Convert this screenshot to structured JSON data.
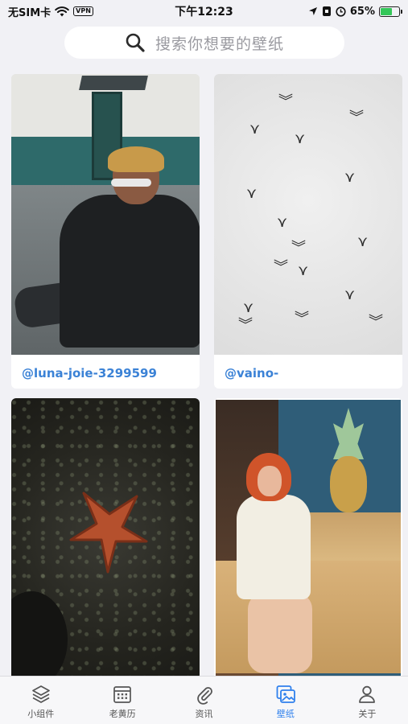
{
  "status_bar": {
    "carrier": "无SIM卡",
    "vpn": "VPN",
    "time": "下午12:23",
    "battery": "65%",
    "battery_level": 0.65
  },
  "search": {
    "placeholder": "搜索你想要的壁纸"
  },
  "wallpapers": [
    {
      "author": "@luna-joie-3299599"
    },
    {
      "author": "@vaino-"
    }
  ],
  "tabs": [
    {
      "label": "小组件",
      "icon": "layers-icon",
      "active": false
    },
    {
      "label": "老黄历",
      "icon": "calendar-icon",
      "active": false
    },
    {
      "label": "资讯",
      "icon": "paperclip-icon",
      "active": false
    },
    {
      "label": "壁纸",
      "icon": "gallery-icon",
      "active": true
    },
    {
      "label": "关于",
      "icon": "person-icon",
      "active": false
    }
  ],
  "colors": {
    "accent": "#2f80ed",
    "author_link": "#3b82d6",
    "background": "#f1f1f5"
  }
}
